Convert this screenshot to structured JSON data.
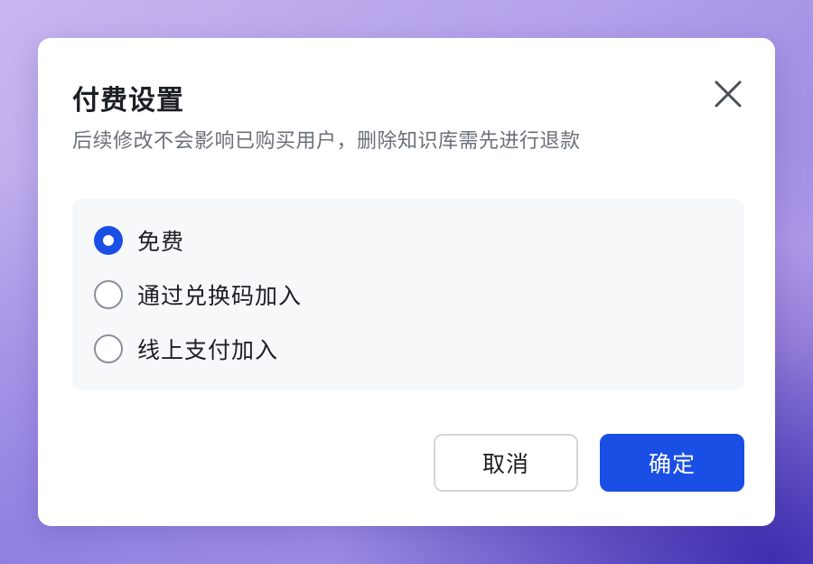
{
  "dialog": {
    "title": "付费设置",
    "subtitle": "后续修改不会影响已购买用户，删除知识库需先进行退款",
    "close_icon": "close-icon"
  },
  "options": [
    {
      "label": "免费",
      "selected": true
    },
    {
      "label": "通过兑换码加入",
      "selected": false
    },
    {
      "label": "线上支付加入",
      "selected": false
    }
  ],
  "buttons": {
    "cancel_label": "取消",
    "confirm_label": "确定"
  },
  "colors": {
    "accent": "#1a4fe6",
    "title_text": "#1c1f23",
    "subtitle_text": "#6b7079",
    "options_bg": "#f7f8fa"
  }
}
